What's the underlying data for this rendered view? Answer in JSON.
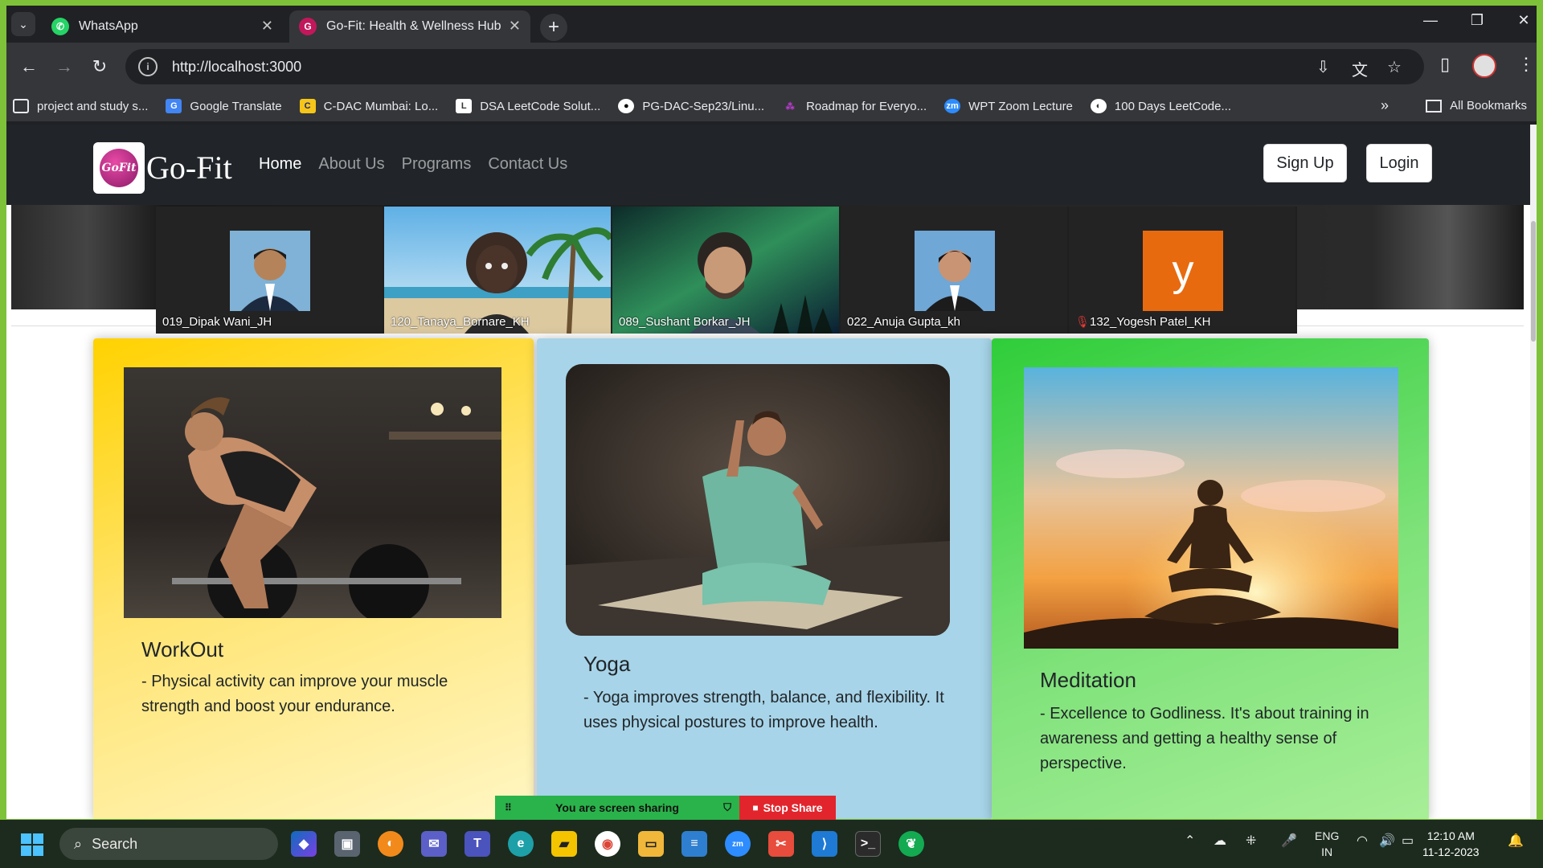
{
  "browser": {
    "tabs": [
      {
        "title": "WhatsApp"
      },
      {
        "title": "Go-Fit: Health & Wellness Hub"
      }
    ],
    "url": "http://localhost:3000",
    "bookmarks": [
      {
        "label": "project and study s..."
      },
      {
        "label": "Google Translate"
      },
      {
        "label": "C-DAC Mumbai: Lo..."
      },
      {
        "label": "DSA LeetCode Solut..."
      },
      {
        "label": "PG-DAC-Sep23/Linu..."
      },
      {
        "label": "Roadmap for Everyo..."
      },
      {
        "label": "WPT Zoom Lecture"
      },
      {
        "label": "100 Days LeetCode..."
      }
    ],
    "all_bookmarks": "All Bookmarks"
  },
  "site": {
    "brand": "Go-Fit",
    "logo_text": "GoFit",
    "nav": {
      "home": "Home",
      "about": "About Us",
      "programs": "Programs",
      "contact": "Contact Us"
    },
    "signup": "Sign Up",
    "login": "Login"
  },
  "zoom": {
    "participants": [
      {
        "name": "019_Dipak Wani_JH"
      },
      {
        "name": "120_Tanaya_Bornare_KH"
      },
      {
        "name": "089_Sushant Borkar_JH"
      },
      {
        "name": "022_Anuja Gupta_kh"
      },
      {
        "name": "132_Yogesh Patel_KH",
        "initial": "y"
      }
    ]
  },
  "cards": [
    {
      "title": "WorkOut",
      "text": "- Physical activity can improve your muscle strength and boost your endurance."
    },
    {
      "title": "Yoga",
      "text": "- Yoga improves strength, balance, and flexibility. It uses physical postures to improve health."
    },
    {
      "title": "Meditation",
      "text": "- Excellence to Godliness. It's about training in awareness and getting a healthy sense of perspective."
    }
  ],
  "sharebar": {
    "status": "You are screen sharing",
    "stop": "Stop Share"
  },
  "taskbar": {
    "search": "Search",
    "lang_top": "ENG",
    "lang_bottom": "IN",
    "time": "12:10 AM",
    "date": "11-12-2023"
  },
  "colors": {
    "navbar": "#212529",
    "workout_card": "#ffd200",
    "yoga_card": "#a7d4e8",
    "meditation_card": "#2fcd3a",
    "share_green": "#2ab34b",
    "share_red": "#e2252c"
  }
}
